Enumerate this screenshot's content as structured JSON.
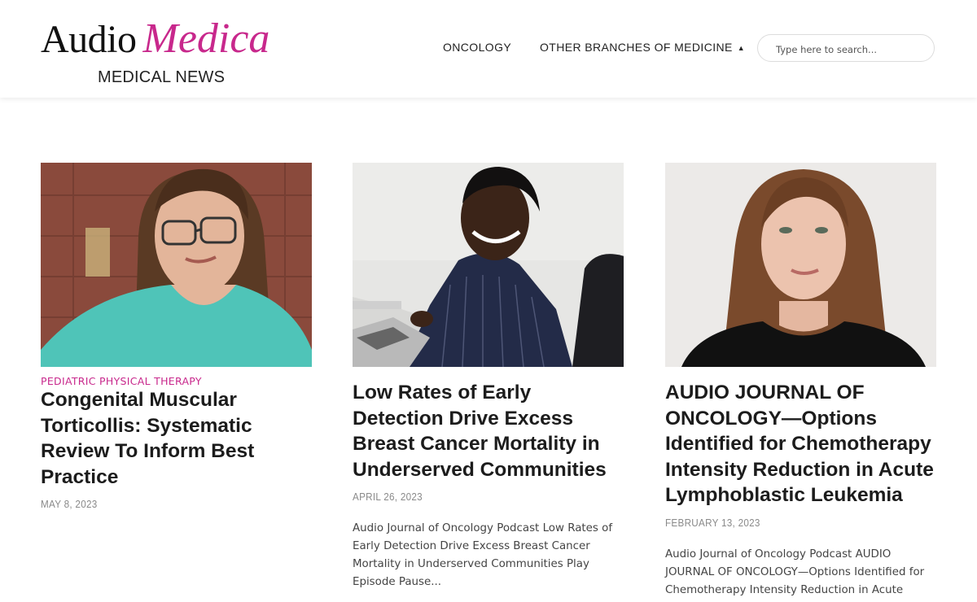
{
  "header": {
    "logo": {
      "audio": "Audio",
      "medica": "Medica",
      "subtitle": "MEDICAL NEWS"
    },
    "nav": [
      {
        "label": "ONCOLOGY"
      },
      {
        "label": "OTHER BRANCHES OF MEDICINE",
        "caret": "▲"
      }
    ],
    "search": {
      "placeholder": "Type here to search..."
    }
  },
  "colors": {
    "brand": "#c8288c",
    "text": "#1c1c1c",
    "date": "#8a8a8a"
  },
  "articles": [
    {
      "category": "PEDIATRIC PHYSICAL THERAPY",
      "title": "Congenital Muscular Torticollis: Systematic Review To Inform Best Practice",
      "date": "MAY 8, 2023",
      "excerpt": "",
      "image": "woman-with-glasses-photo"
    },
    {
      "category": "",
      "title": "Low Rates of Early Detection Drive Excess Breast Cancer Mortality in Underserved Communities",
      "date": "APRIL 26, 2023",
      "excerpt": "Audio Journal of Oncology Podcast Low Rates of Early Detection Drive Excess Breast Cancer Mortality in Underserved Communities Play Episode Pause...",
      "image": "smiling-woman-at-laptop-photo"
    },
    {
      "category": "",
      "title": "AUDIO JOURNAL OF ONCOLOGY—Options Identified for Chemotherapy Intensity Reduction in Acute Lymphoblastic Leukemia",
      "date": "FEBRUARY 13, 2023",
      "excerpt": "Audio Journal of Oncology Podcast AUDIO JOURNAL OF ONCOLOGY—Options Identified for Chemotherapy Intensity Reduction in Acute",
      "image": "woman-portrait-photo"
    }
  ]
}
